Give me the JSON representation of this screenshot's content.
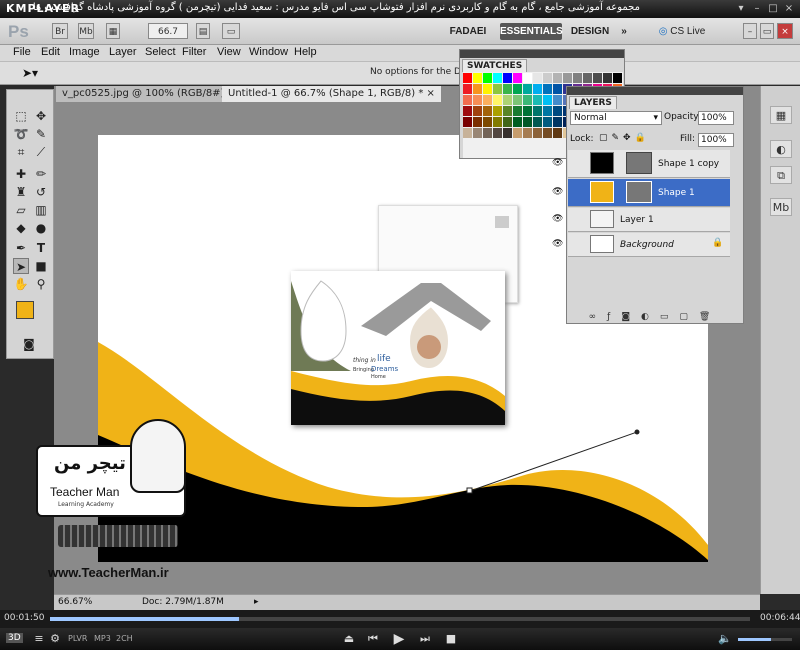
{
  "player": {
    "name": "KMPLAYER",
    "caption": "مجموعه آموزشی جامع ، گام به گام و کاربردی نرم افزار فتوشاپ سی اس فایو  مدرس : سعید فدایی (تیچرمن ) گروه آموزشی پادشاه گرافیست ها",
    "time_current": "00:01:50",
    "time_total": "00:06:44",
    "badges": [
      "3D",
      "PLVR",
      "MP3",
      "2CH"
    ],
    "progress": 0.27,
    "volume": 0.62
  },
  "ps": {
    "logo": "Ps",
    "app_icons": [
      "Br",
      "Mb"
    ],
    "zoom_field": "66.7",
    "workspaces": [
      "FADAEI",
      "ESSENTIALS",
      "DESIGN"
    ],
    "workspace_more": "»",
    "cs_live": "CS Live",
    "menu": [
      "File",
      "Edit",
      "Image",
      "Layer",
      "Select",
      "Filter",
      "View",
      "Window",
      "Help"
    ],
    "options_text": "No options for the Direct",
    "tabs": [
      {
        "label": "v_pc0525.jpg @ 100% (RGB/8#)",
        "close": "×"
      },
      {
        "label": "Untitled-1 @ 66.7% (Shape 1, RGB/8) *",
        "close": "×"
      }
    ],
    "status_zoom": "66.67%",
    "status_doc": "Doc: 2.79M/1.87M",
    "colors": {
      "foreground": "#f0b317",
      "background": "#ffffff",
      "selection": "#3c6cc6"
    }
  },
  "swatches": {
    "title": "SWATCHES"
  },
  "layers": {
    "title": "LAYERS",
    "blend_mode": "Normal",
    "opacity_label": "Opacity:",
    "opacity": "100%",
    "lock_label": "Lock:",
    "fill_label": "Fill:",
    "fill": "100%",
    "rows": [
      {
        "name": "Shape 1 copy",
        "selected": false,
        "thumb": "#000000"
      },
      {
        "name": "Shape 1",
        "selected": true,
        "thumb": "#f0b317"
      },
      {
        "name": "Layer 1",
        "selected": false,
        "thumb": "#f4f4f4"
      },
      {
        "name": "Background",
        "selected": false,
        "thumb": "#ffffff"
      }
    ],
    "footer_icons": [
      "link-icon",
      "fx-icon",
      "mask-icon",
      "adjustment-icon",
      "group-icon",
      "new-layer-icon",
      "trash-icon"
    ]
  },
  "brochure": {
    "tagline_1": "thing in",
    "tagline_2": "life",
    "tagline_3": "Bringing",
    "tagline_4": "Dreams",
    "tagline_5": "Home"
  },
  "watermark": {
    "site": "www.TeacherMan.ir",
    "persian": "تیچر من",
    "subtitle": "Teacher Man",
    "small": "Learning Academy"
  }
}
